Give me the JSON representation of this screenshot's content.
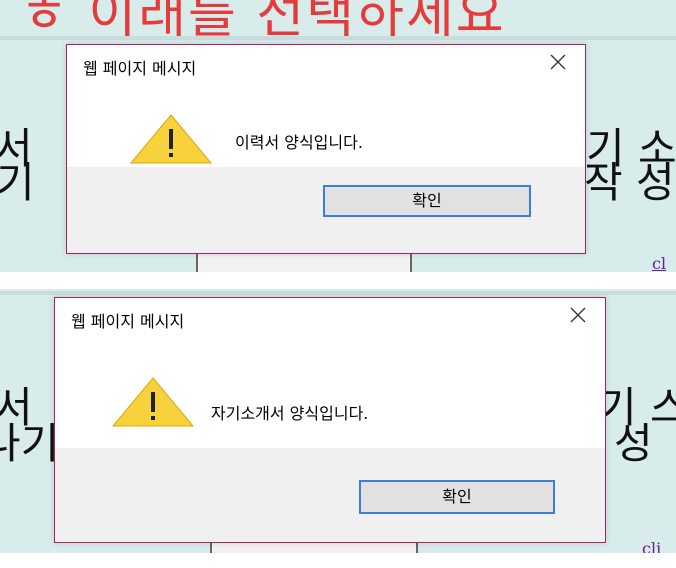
{
  "top_panel": {
    "background_title": "ㅎ 이래를 선택하세요",
    "background_left": [
      "서",
      "기"
    ],
    "background_right": [
      "기 소",
      "작 성"
    ],
    "background_link": "cl",
    "dialog": {
      "title": "웹 페이지 메시지",
      "message": "이력서 양식입니다.",
      "ok_label": "확인",
      "icon": "warning-icon",
      "close_icon": "close-icon"
    }
  },
  "bottom_panel": {
    "background_left": [
      "서",
      "나기"
    ],
    "background_right": [
      "기 스",
      "성"
    ],
    "background_link": "cli",
    "dialog": {
      "title": "웹 페이지 메시지",
      "message": "자기소개서 양식입니다.",
      "ok_label": "확인",
      "icon": "warning-icon",
      "close_icon": "close-icon"
    }
  },
  "colors": {
    "dialog_border": "#b0225e",
    "button_focus": "#3d7fd6",
    "footer": "#f0f0f0",
    "warning_fill": "#f7d23d",
    "background_teal": "#d9ecec",
    "background_red_text": "#e43c3c"
  }
}
